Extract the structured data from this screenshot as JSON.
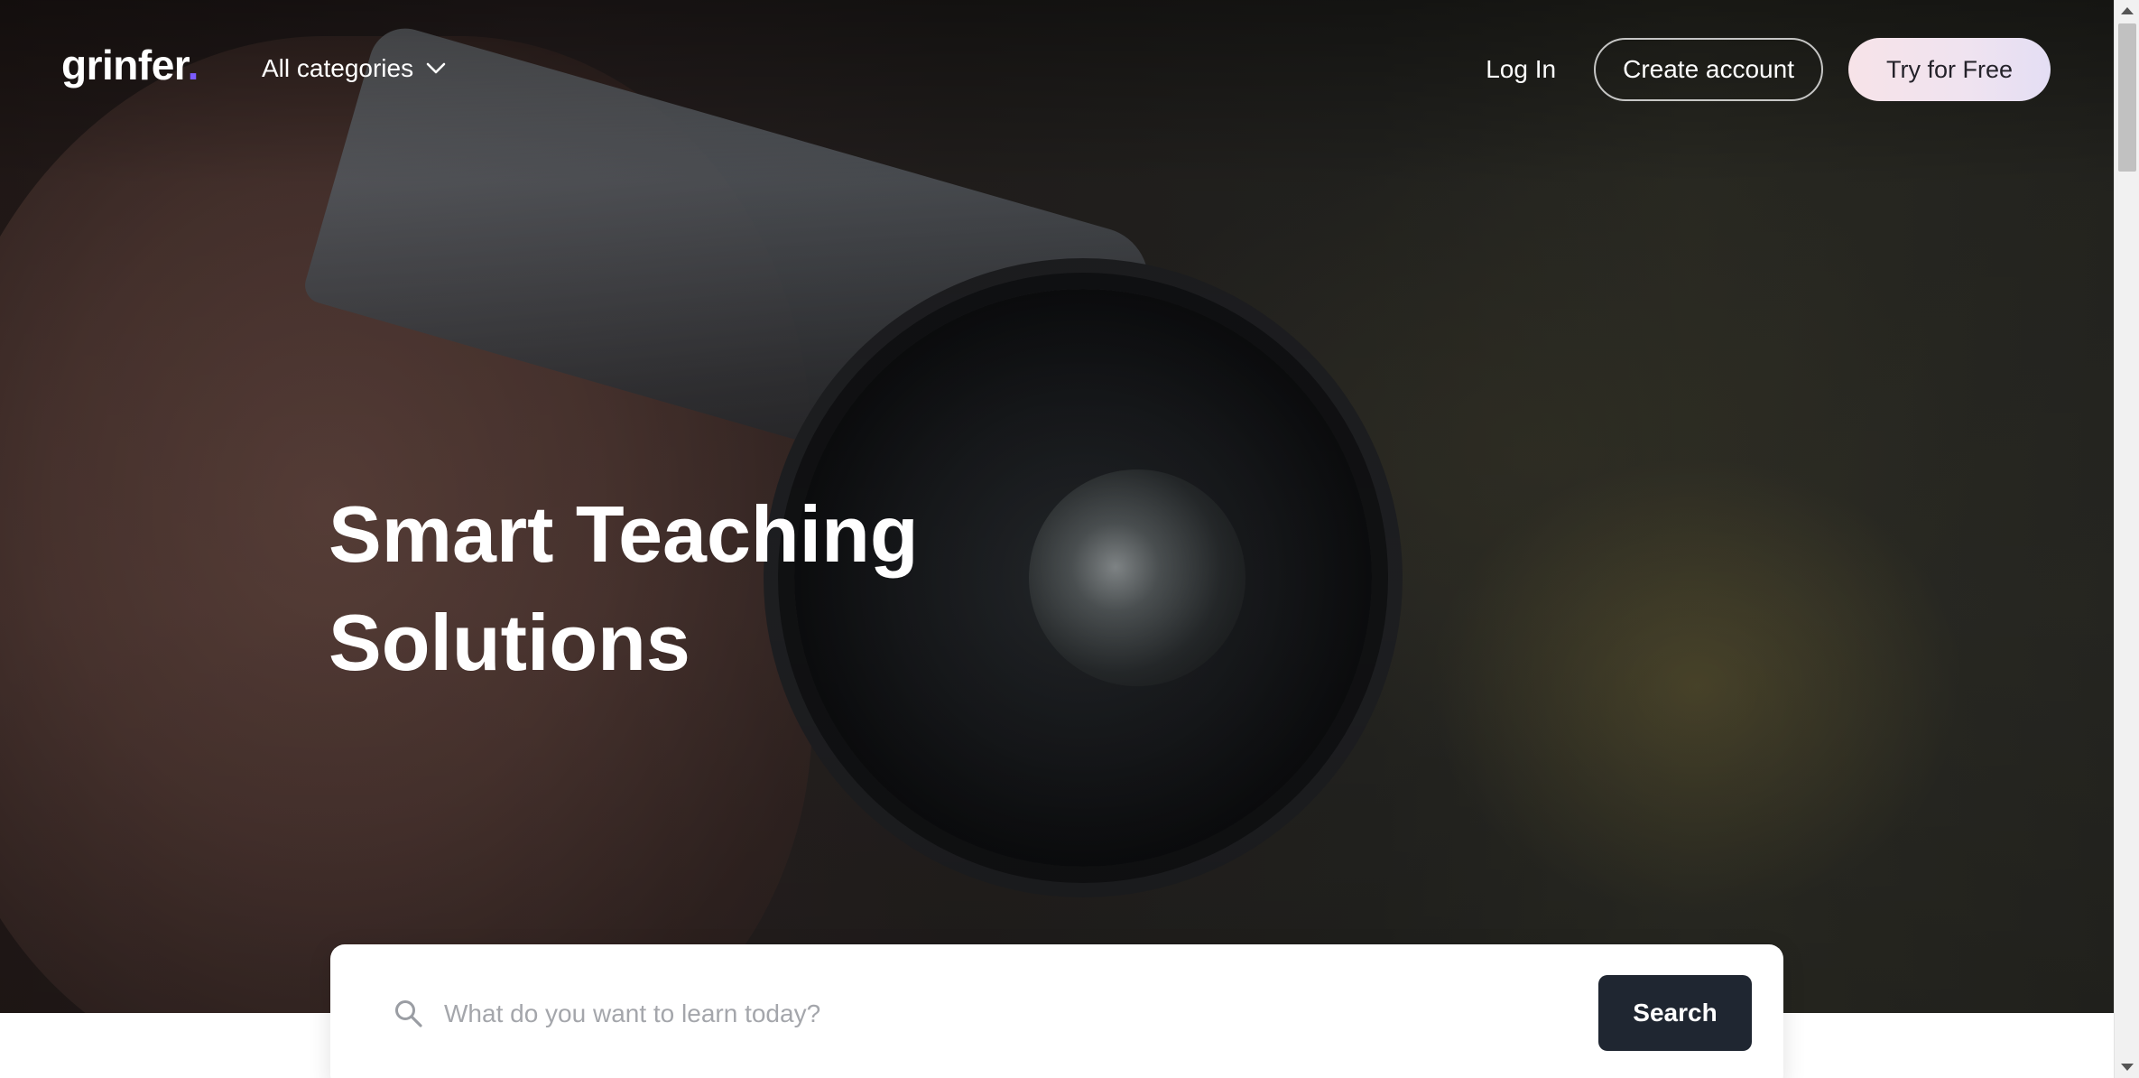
{
  "header": {
    "logo_text": "grinfer",
    "logo_dot": ".",
    "categories_label": "All categories",
    "login_label": "Log In",
    "create_account_label": "Create account",
    "try_free_label": "Try for Free"
  },
  "hero": {
    "title_line1": "Smart Teaching",
    "title_line2": "Solutions",
    "background_image": "camera-photo"
  },
  "search": {
    "placeholder": "What do you want to learn today?",
    "value": "",
    "button_label": "Search"
  },
  "colors": {
    "logo_accent": "#7c5cff",
    "search_button": "#1f2631",
    "try_button_gradient_start": "#f7e3e8",
    "try_button_gradient_end": "#e4def4"
  },
  "icons": {
    "categories": "chevron-down-icon",
    "search": "search-icon"
  }
}
